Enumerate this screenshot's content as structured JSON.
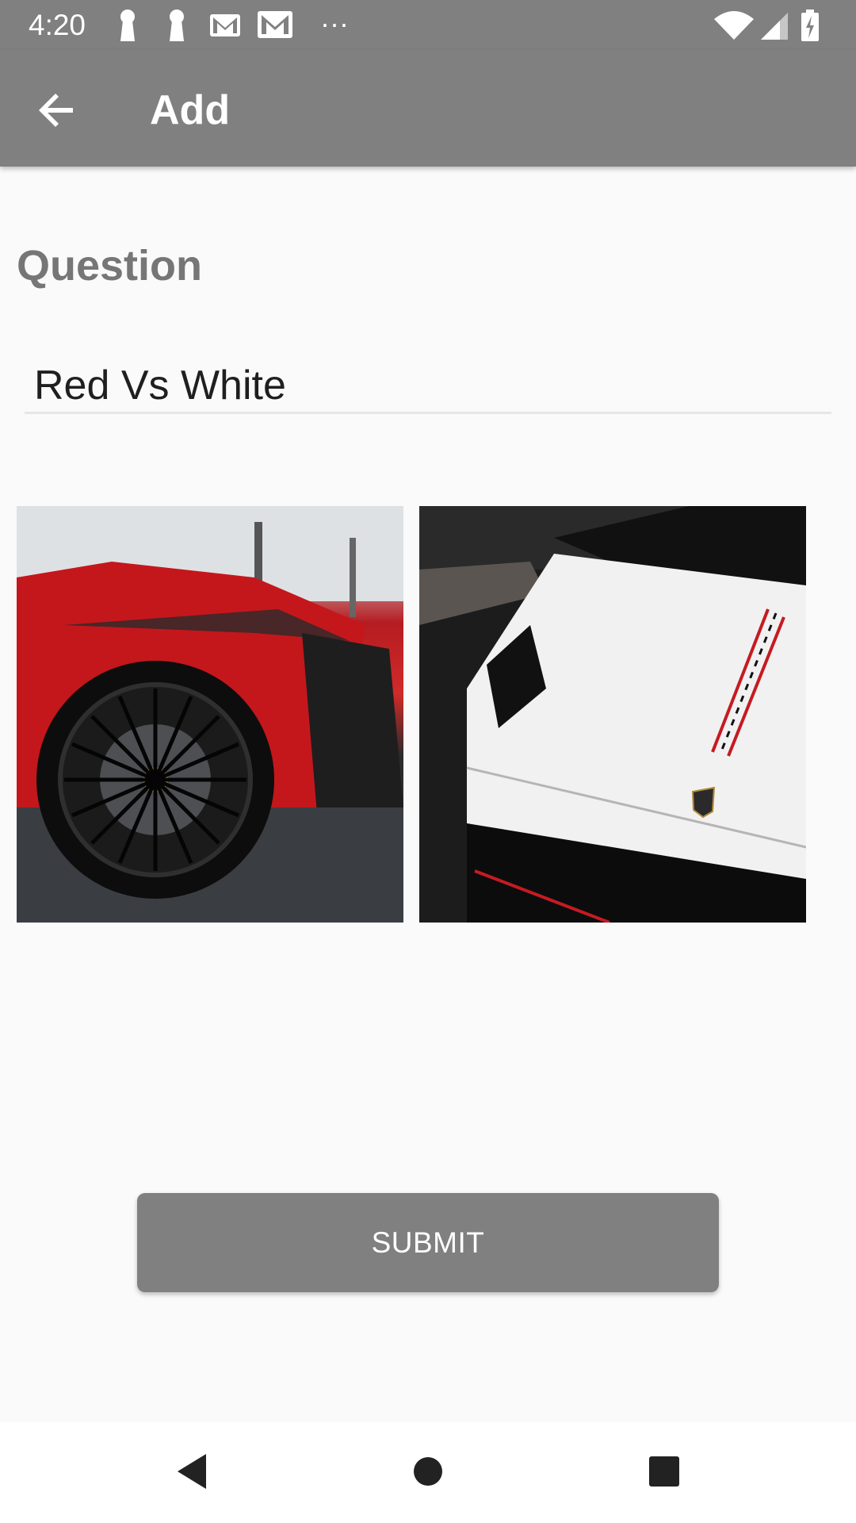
{
  "status_bar": {
    "time": "4:20",
    "left_icons": [
      "keyhole-icon",
      "keyhole-icon",
      "gmail-icon",
      "gmail-icon",
      "more-icon"
    ],
    "right_icons": [
      "wifi-icon",
      "signal-icon",
      "battery-icon"
    ],
    "more_glyph": "···"
  },
  "app_bar": {
    "title": "Add",
    "back_icon": "arrow-back-icon"
  },
  "form": {
    "question_label": "Question",
    "question_value": "Red Vs White"
  },
  "images": [
    {
      "name": "red-car-image"
    },
    {
      "name": "white-car-image"
    }
  ],
  "submit_label": "SUBMIT",
  "nav": {
    "back_icon": "nav-back-icon",
    "home_icon": "nav-home-icon",
    "recents_icon": "nav-recents-icon"
  },
  "colors": {
    "bar": "#808080",
    "background": "#fafafa",
    "label": "#767676"
  }
}
